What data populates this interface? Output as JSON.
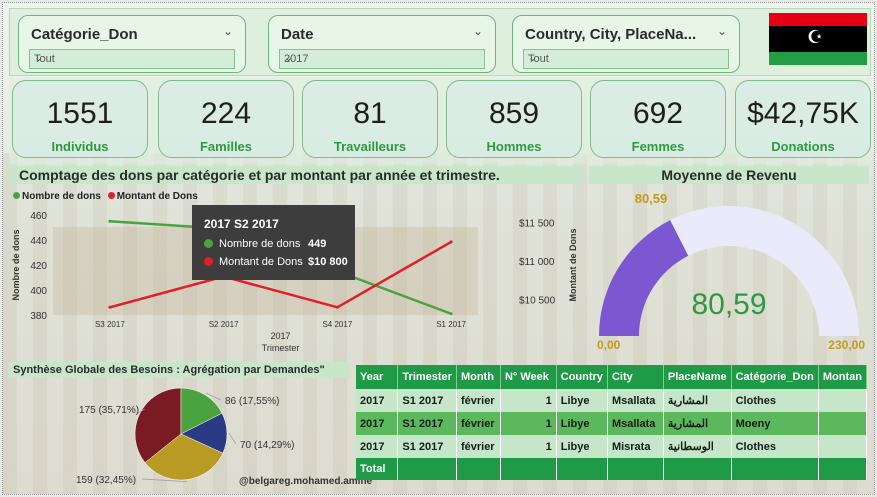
{
  "slicers": [
    {
      "title": "Catégorie_Don",
      "value": "Tout"
    },
    {
      "title": "Date",
      "value": "2017"
    },
    {
      "title": "Country, City, PlaceNa...",
      "value": "Tout"
    }
  ],
  "kpis": [
    {
      "value": "1551",
      "label": "Individus"
    },
    {
      "value": "224",
      "label": "Familles"
    },
    {
      "value": "81",
      "label": "Travailleurs"
    },
    {
      "value": "859",
      "label": "Hommes"
    },
    {
      "value": "692",
      "label": "Femmes"
    },
    {
      "value": "$42,75K",
      "label": "Donations"
    }
  ],
  "combo_chart": {
    "title": "Comptage des dons par catégorie et par montant par année et trimestre.",
    "legend": [
      "Nombre de dons",
      "Montant de Dons"
    ],
    "colors": {
      "count": "#4aa33e",
      "amount": "#e01f26"
    },
    "y_left_label": "Nombre de dons",
    "y_right_label": "Montant de Dons",
    "x_label_line1": "2017",
    "x_label_line2": "Trimester",
    "y_left_ticks": [
      "460",
      "440",
      "420",
      "400",
      "380"
    ],
    "y_right_ticks": [
      "$11 500",
      "$11 000",
      "$10 500"
    ],
    "tooltip": {
      "title": "2017 S2 2017",
      "rows": [
        {
          "label": "Nombre de dons",
          "value": "449"
        },
        {
          "label": "Montant de Dons",
          "value": "$10 800"
        }
      ]
    }
  },
  "gauge": {
    "title": "Moyenne de Revenu",
    "value": "80,59",
    "min": "0,00",
    "max": "230,00",
    "top_label": "80,59",
    "colors": {
      "fill": "#7b57d1",
      "track": "#eaeafa",
      "value": "#2e9a3e"
    }
  },
  "pie": {
    "title": "Synthèse Globale des Besoins : Agrégation par Demandes\"",
    "labels": [
      "175 (35,71%)",
      "86 (17,55%)",
      "70 (14,29%)",
      "159 (32,45%)"
    ]
  },
  "watermark": "@belgareg.mohamed.amine",
  "table": {
    "headers": [
      "Year",
      "Trimester",
      "Month",
      "N° Week",
      "Country",
      "City",
      "PlaceName",
      "Catégorie_Don",
      "Montan"
    ],
    "rows": [
      [
        "2017",
        "S1 2017",
        "février",
        "1",
        "Libye",
        "Msallata",
        "المشارية",
        "Clothes",
        ""
      ],
      [
        "2017",
        "S1 2017",
        "février",
        "1",
        "Libye",
        "Msallata",
        "المشارية",
        "Moeny",
        ""
      ],
      [
        "2017",
        "S1 2017",
        "février",
        "1",
        "Libye",
        "Misrata",
        "الوسطانية",
        "Clothes",
        ""
      ]
    ],
    "total_label": "Total"
  },
  "chart_data": [
    {
      "type": "line",
      "title": "Comptage des dons par catégorie et par montant par année et trimestre.",
      "categories": [
        "S3 2017",
        "S2 2017",
        "S4 2017",
        "S1 2017"
      ],
      "xlabel": "Trimester",
      "series": [
        {
          "name": "Nombre de dons",
          "axis": "left",
          "values": [
            455,
            449,
            415,
            381
          ]
        },
        {
          "name": "Montant de Dons",
          "axis": "right",
          "values": [
            10400,
            10800,
            10400,
            11250
          ]
        }
      ],
      "ylim_left": [
        380,
        460
      ],
      "ylim_right": [
        10300,
        11600
      ]
    },
    {
      "type": "pie",
      "title": "Synthèse Globale des Besoins : Agrégation par Demandes\"",
      "slices": [
        {
          "value": 175,
          "pct": 35.71,
          "color": "#7a1a22"
        },
        {
          "value": 86,
          "pct": 17.55,
          "color": "#4aa33e"
        },
        {
          "value": 70,
          "pct": 14.29,
          "color": "#2b3a84"
        },
        {
          "value": 159,
          "pct": 32.45,
          "color": "#b99a25"
        }
      ]
    }
  ]
}
